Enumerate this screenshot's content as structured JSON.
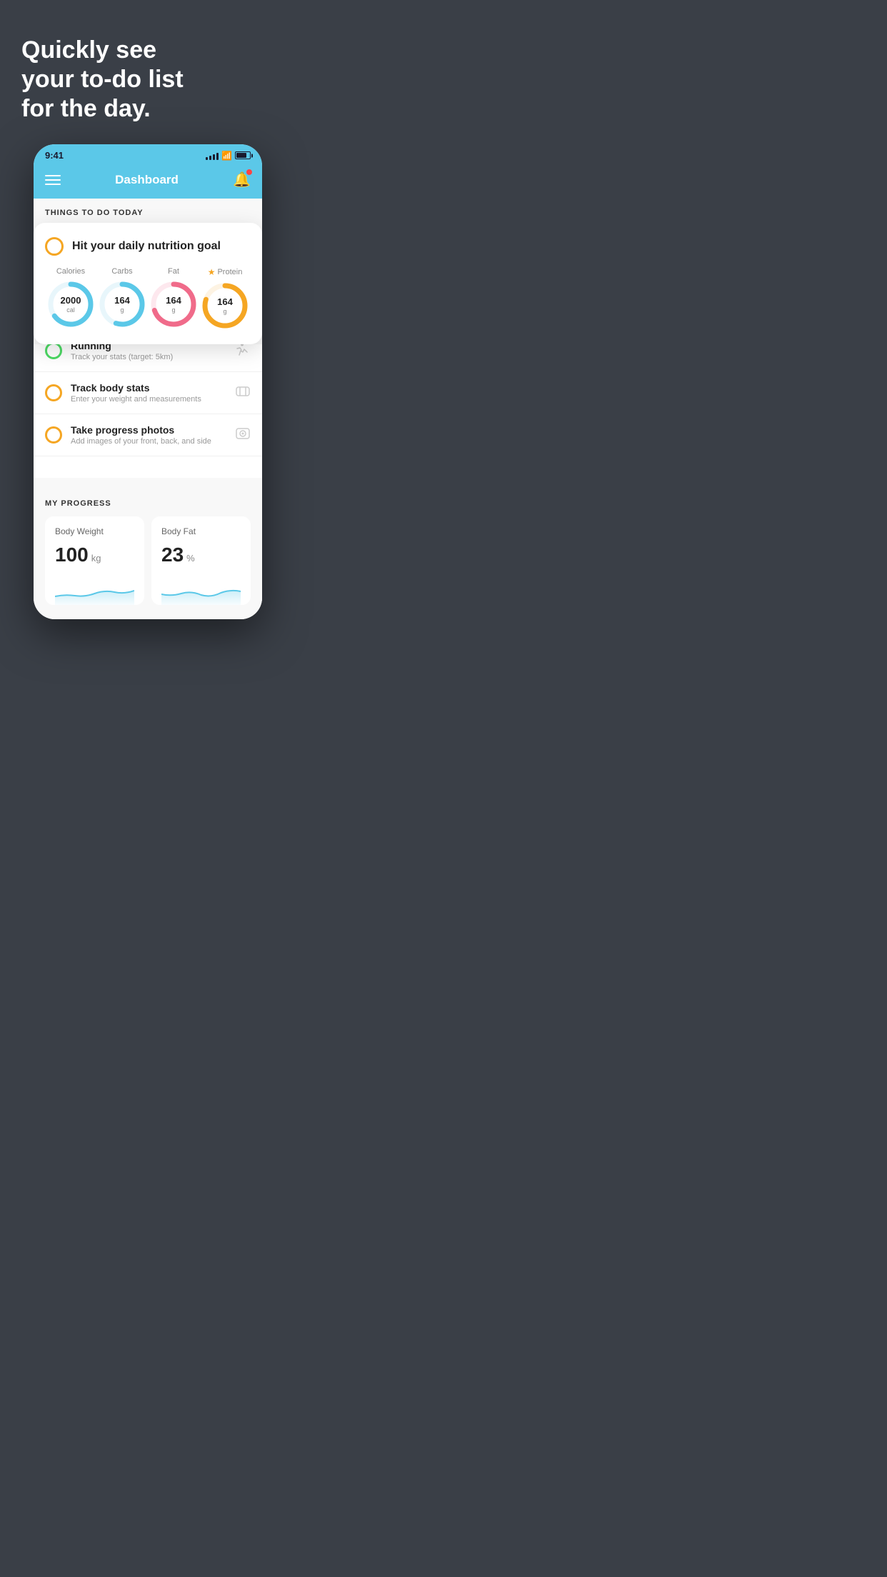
{
  "hero": {
    "line1": "Quickly see",
    "line2": "your to-do list",
    "line3": "for the day."
  },
  "phone": {
    "statusBar": {
      "time": "9:41"
    },
    "header": {
      "title": "Dashboard"
    },
    "sectionLabel": "THINGS TO DO TODAY",
    "floatingCard": {
      "checkIcon": "circle",
      "title": "Hit your daily nutrition goal",
      "calories": {
        "label": "Calories",
        "value": "2000",
        "unit": "cal",
        "color": "#5bc8e8",
        "percent": 65
      },
      "carbs": {
        "label": "Carbs",
        "value": "164",
        "unit": "g",
        "color": "#5bc8e8",
        "percent": 55
      },
      "fat": {
        "label": "Fat",
        "value": "164",
        "unit": "g",
        "color": "#f06b8a",
        "percent": 70
      },
      "protein": {
        "label": "Protein",
        "value": "164",
        "unit": "g",
        "color": "#f5a623",
        "percent": 80,
        "starred": true
      }
    },
    "todoItems": [
      {
        "id": "running",
        "title": "Running",
        "subtitle": "Track your stats (target: 5km)",
        "circleColor": "green",
        "iconSymbol": "👟"
      },
      {
        "id": "body-stats",
        "title": "Track body stats",
        "subtitle": "Enter your weight and measurements",
        "circleColor": "yellow",
        "iconSymbol": "⚖"
      },
      {
        "id": "progress-photos",
        "title": "Take progress photos",
        "subtitle": "Add images of your front, back, and side",
        "circleColor": "yellow",
        "iconSymbol": "👤"
      }
    ],
    "progressSection": {
      "header": "MY PROGRESS",
      "cards": [
        {
          "id": "body-weight",
          "title": "Body Weight",
          "value": "100",
          "unit": "kg"
        },
        {
          "id": "body-fat",
          "title": "Body Fat",
          "value": "23",
          "unit": "%"
        }
      ]
    }
  }
}
